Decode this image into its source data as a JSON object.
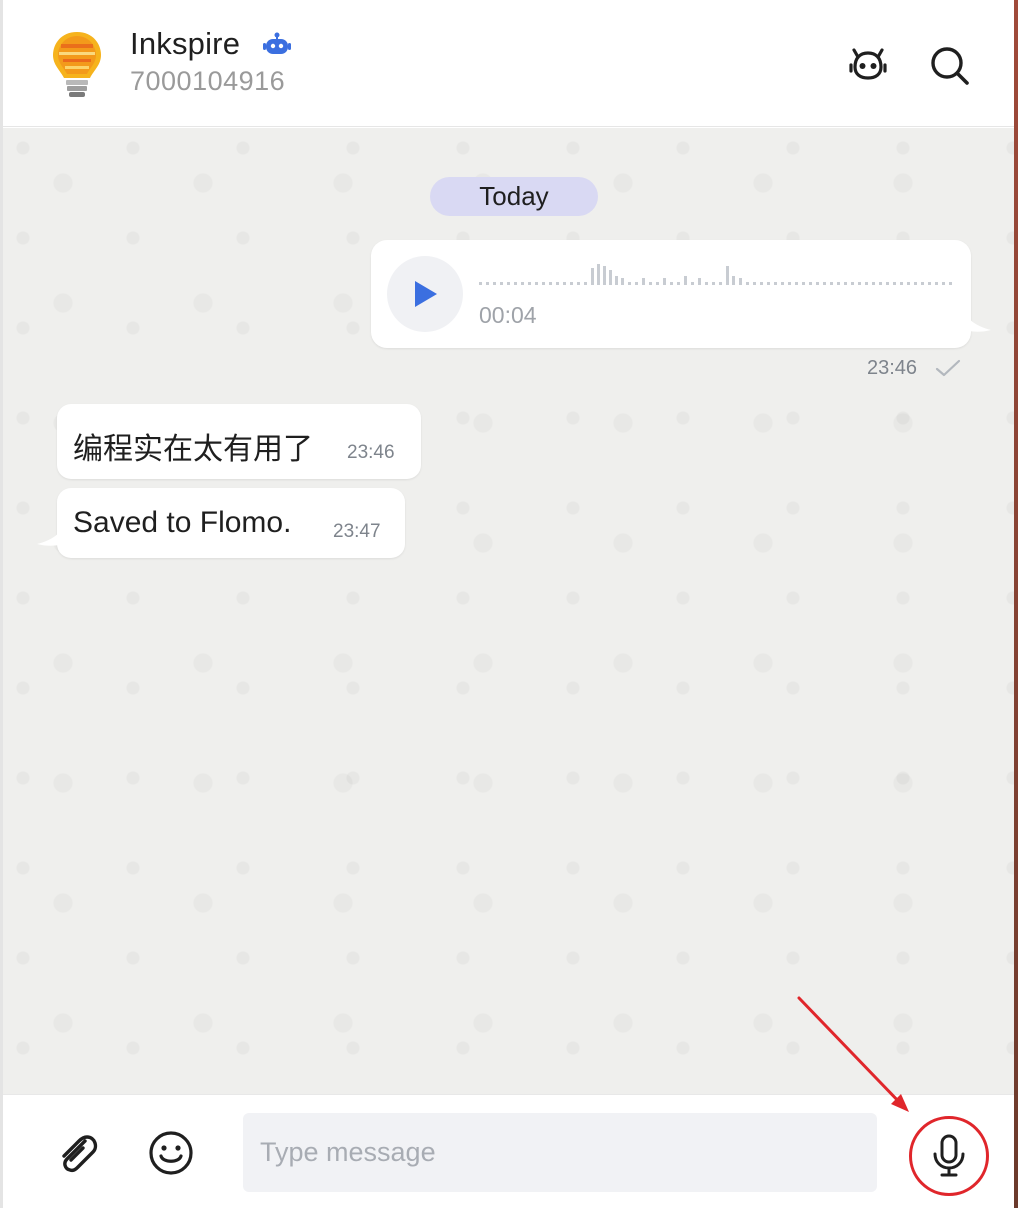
{
  "header": {
    "title": "Inkspire",
    "subtitle": "7000104916",
    "avatar_icon": "lightbulb-ideas-avatar",
    "badge_icon": "bot-badge-icon",
    "actions": [
      "bot-icon",
      "search-icon"
    ]
  },
  "chat": {
    "day_chip": "Today",
    "outgoing_voice": {
      "duration": "00:04",
      "time": "23:46",
      "status_icon": "check-icon"
    },
    "incoming": [
      {
        "text": "编程实在太有用了",
        "time": "23:46"
      },
      {
        "text": "Saved to Flomo.",
        "time": "23:47"
      }
    ]
  },
  "input": {
    "placeholder": "Type message",
    "value": "",
    "buttons": [
      "paperclip-icon",
      "emoji-icon",
      "microphone-icon"
    ]
  },
  "colors": {
    "accent_blue": "#3b6fe0",
    "day_chip_bg": "#d9d9f3",
    "chat_bg": "#efefed",
    "annotation_red": "#e0262b"
  }
}
